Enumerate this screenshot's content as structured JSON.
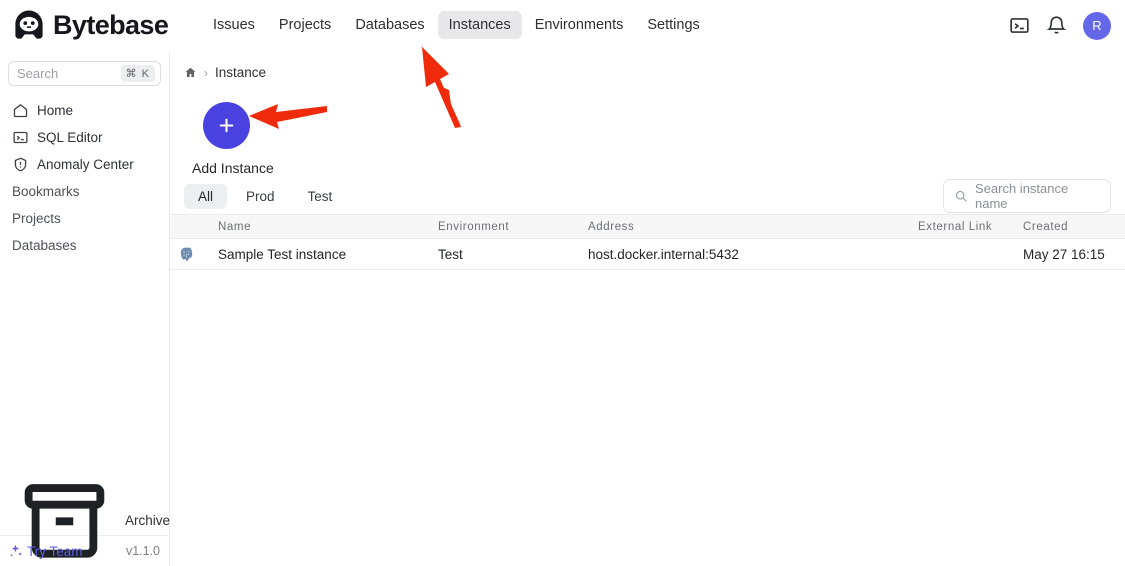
{
  "header": {
    "brand": "Bytebase",
    "logo_icon": "bytebase-logo-icon",
    "nav": [
      {
        "label": "Issues",
        "active": false
      },
      {
        "label": "Projects",
        "active": false
      },
      {
        "label": "Databases",
        "active": false
      },
      {
        "label": "Instances",
        "active": true
      },
      {
        "label": "Environments",
        "active": false
      },
      {
        "label": "Settings",
        "active": false
      }
    ],
    "terminal_icon": "terminal-icon",
    "bell_icon": "bell-icon",
    "avatar_initial": "R",
    "avatar_color": "#6468e8"
  },
  "sidebar": {
    "search": {
      "placeholder": "Search",
      "shortcut": "⌘ K",
      "icon": "search-input"
    },
    "items": [
      {
        "label": "Home",
        "icon": "home-icon",
        "has_icon": true
      },
      {
        "label": "SQL Editor",
        "icon": "terminal-icon",
        "has_icon": true
      },
      {
        "label": "Anomaly Center",
        "icon": "shield-alert-icon",
        "has_icon": true
      },
      {
        "label": "Bookmarks",
        "icon": "",
        "has_icon": false
      },
      {
        "label": "Projects",
        "icon": "",
        "has_icon": false
      },
      {
        "label": "Databases",
        "icon": "",
        "has_icon": false
      }
    ],
    "archive": {
      "label": "Archive",
      "icon": "archive-box-icon"
    },
    "try_team": {
      "label": "Try Team",
      "icon": "sparkle-icon",
      "color": "#5b5fe0"
    },
    "version": "v1.1.0"
  },
  "main": {
    "breadcrumb": {
      "home_icon": "home-icon",
      "separator": "›",
      "current": "Instance"
    },
    "add_instance": {
      "label": "Add Instance",
      "icon": "plus-icon",
      "color": "#4a42e0"
    },
    "tabs": [
      {
        "label": "All",
        "active": true
      },
      {
        "label": "Prod",
        "active": false
      },
      {
        "label": "Test",
        "active": false
      }
    ],
    "instance_search": {
      "placeholder": "Search instance name",
      "icon": "search-icon"
    },
    "table": {
      "columns": [
        "Name",
        "Environment",
        "Address",
        "External Link",
        "Created"
      ],
      "rows": [
        {
          "engine_icon": "postgresql-elephant-icon",
          "name": "Sample Test instance",
          "environment": "Test",
          "address": "host.docker.internal:5432",
          "external_link": "",
          "created": "May 27 16:15"
        }
      ]
    }
  },
  "annotations": {
    "arrow_color": "#ef2b0c",
    "arrows": [
      {
        "name": "arrow-to-instances-tab",
        "points_to": "Instances"
      },
      {
        "name": "arrow-to-add-instance",
        "points_to": "Add Instance"
      }
    ]
  }
}
